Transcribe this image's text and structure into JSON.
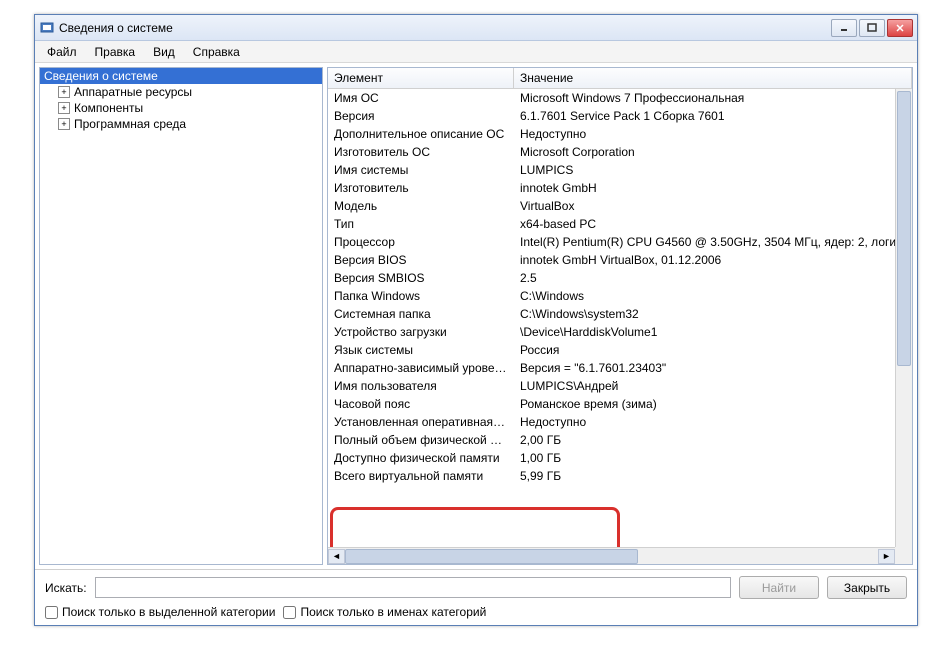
{
  "window": {
    "title": "Сведения о системе"
  },
  "menu": {
    "file": "Файл",
    "edit": "Правка",
    "view": "Вид",
    "help": "Справка"
  },
  "tree": {
    "root": "Сведения о системе",
    "items": [
      "Аппаратные ресурсы",
      "Компоненты",
      "Программная среда"
    ]
  },
  "table": {
    "head": {
      "col1": "Элемент",
      "col2": "Значение"
    },
    "rows": [
      {
        "k": "Имя ОС",
        "v": "Microsoft Windows 7 Профессиональная"
      },
      {
        "k": "Версия",
        "v": "6.1.7601 Service Pack 1 Сборка 7601"
      },
      {
        "k": "Дополнительное описание ОС",
        "v": "Недоступно"
      },
      {
        "k": "Изготовитель ОС",
        "v": "Microsoft Corporation"
      },
      {
        "k": "Имя системы",
        "v": "LUMPICS"
      },
      {
        "k": "Изготовитель",
        "v": "innotek GmbH"
      },
      {
        "k": "Модель",
        "v": "VirtualBox"
      },
      {
        "k": "Тип",
        "v": "x64-based PC"
      },
      {
        "k": "Процессор",
        "v": "Intel(R) Pentium(R) CPU G4560 @ 3.50GHz, 3504 МГц, ядер: 2, логи"
      },
      {
        "k": "Версия BIOS",
        "v": "innotek GmbH VirtualBox, 01.12.2006"
      },
      {
        "k": "Версия SMBIOS",
        "v": "2.5"
      },
      {
        "k": "Папка Windows",
        "v": "C:\\Windows"
      },
      {
        "k": "Системная папка",
        "v": "C:\\Windows\\system32"
      },
      {
        "k": "Устройство загрузки",
        "v": "\\Device\\HarddiskVolume1"
      },
      {
        "k": "Язык системы",
        "v": "Россия"
      },
      {
        "k": "Аппаратно-зависимый уровен...",
        "v": "Версия = \"6.1.7601.23403\""
      },
      {
        "k": "Имя пользователя",
        "v": "LUMPICS\\Андрей"
      },
      {
        "k": "Часовой пояс",
        "v": "Романское время (зима)"
      },
      {
        "k": "Установленная оперативная п...",
        "v": "Недоступно"
      },
      {
        "k": "Полный объем физической па...",
        "v": "2,00 ГБ"
      },
      {
        "k": "Доступно физической памяти",
        "v": "1,00 ГБ"
      },
      {
        "k": "Всего виртуальной памяти",
        "v": "5,99 ГБ"
      }
    ]
  },
  "search": {
    "label": "Искать:",
    "find": "Найти",
    "close": "Закрыть",
    "chk1": "Поиск только в выделенной категории",
    "chk2": "Поиск только в именах категорий"
  }
}
